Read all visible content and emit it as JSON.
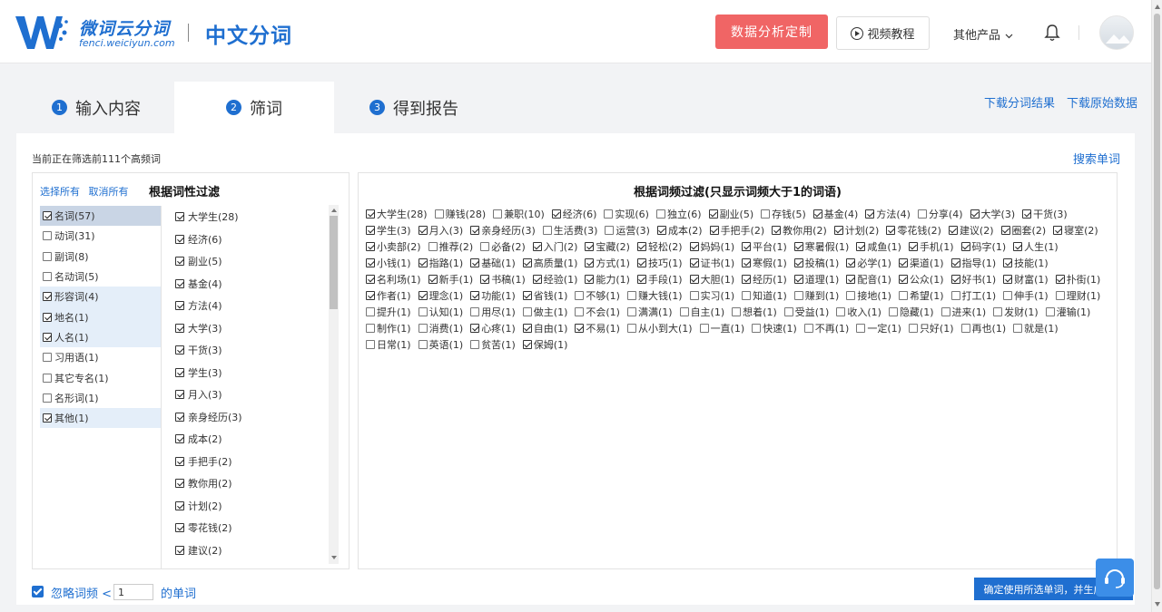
{
  "header": {
    "logo_cn": "微词云分词",
    "logo_en": "fenci.weiciyun.com",
    "subtitle": "中文分词",
    "analysis_button": "数据分析定制",
    "video_button": "视频教程",
    "other_products": "其他产品"
  },
  "steps": [
    {
      "num": "1",
      "label": "输入内容"
    },
    {
      "num": "2",
      "label": "筛词"
    },
    {
      "num": "3",
      "label": "得到报告"
    }
  ],
  "downloads": {
    "segmented": "下载分词结果",
    "raw": "下载原始数据"
  },
  "status": "当前正在筛选前111个高频词",
  "search_word": "搜索单词",
  "left": {
    "select_all": "选择所有",
    "deselect_all": "取消所有",
    "title": "根据词性过滤",
    "pos": [
      {
        "label": "名词(57)",
        "checked": true
      },
      {
        "label": "动词(31)",
        "checked": false
      },
      {
        "label": "副词(8)",
        "checked": false
      },
      {
        "label": "名动词(5)",
        "checked": false
      },
      {
        "label": "形容词(4)",
        "checked": true
      },
      {
        "label": "地名(1)",
        "checked": true
      },
      {
        "label": "人名(1)",
        "checked": true
      },
      {
        "label": "习用语(1)",
        "checked": false
      },
      {
        "label": "其它专名(1)",
        "checked": false
      },
      {
        "label": "名形词(1)",
        "checked": false
      },
      {
        "label": "其他(1)",
        "checked": true
      }
    ],
    "words": [
      "大学生(28)",
      "经济(6)",
      "副业(5)",
      "基金(4)",
      "方法(4)",
      "大学(3)",
      "干货(3)",
      "学生(3)",
      "月入(3)",
      "亲身经历(3)",
      "成本(2)",
      "手把手(2)",
      "教你用(2)",
      "计划(2)",
      "零花钱(2)",
      "建议(2)"
    ]
  },
  "right": {
    "title": "根据词频过滤(只显示词频大于1的词语)",
    "words": [
      {
        "t": "大学生(28)",
        "c": true
      },
      {
        "t": "赚钱(28)",
        "c": false
      },
      {
        "t": "兼职(10)",
        "c": false
      },
      {
        "t": "经济(6)",
        "c": true
      },
      {
        "t": "实现(6)",
        "c": false
      },
      {
        "t": "独立(6)",
        "c": false
      },
      {
        "t": "副业(5)",
        "c": true
      },
      {
        "t": "存钱(5)",
        "c": false
      },
      {
        "t": "基金(4)",
        "c": true
      },
      {
        "t": "方法(4)",
        "c": true
      },
      {
        "t": "分享(4)",
        "c": false
      },
      {
        "t": "大学(3)",
        "c": true
      },
      {
        "t": "干货(3)",
        "c": true
      },
      {
        "t": "学生(3)",
        "c": true
      },
      {
        "t": "月入(3)",
        "c": true
      },
      {
        "t": "亲身经历(3)",
        "c": true
      },
      {
        "t": "生活费(3)",
        "c": false
      },
      {
        "t": "运营(3)",
        "c": false
      },
      {
        "t": "成本(2)",
        "c": true
      },
      {
        "t": "手把手(2)",
        "c": true
      },
      {
        "t": "教你用(2)",
        "c": true
      },
      {
        "t": "计划(2)",
        "c": true
      },
      {
        "t": "零花钱(2)",
        "c": true
      },
      {
        "t": "建议(2)",
        "c": true
      },
      {
        "t": "圈套(2)",
        "c": true
      },
      {
        "t": "寝室(2)",
        "c": true
      },
      {
        "t": "小卖部(2)",
        "c": true
      },
      {
        "t": "推荐(2)",
        "c": false
      },
      {
        "t": "必备(2)",
        "c": false
      },
      {
        "t": "入门(2)",
        "c": true
      },
      {
        "t": "宝藏(2)",
        "c": true
      },
      {
        "t": "轻松(2)",
        "c": true
      },
      {
        "t": "妈妈(1)",
        "c": true
      },
      {
        "t": "平台(1)",
        "c": true
      },
      {
        "t": "寒暑假(1)",
        "c": true
      },
      {
        "t": "咸鱼(1)",
        "c": true
      },
      {
        "t": "手机(1)",
        "c": true
      },
      {
        "t": "码字(1)",
        "c": true
      },
      {
        "t": "人生(1)",
        "c": true
      },
      {
        "t": "小钱(1)",
        "c": true
      },
      {
        "t": "指路(1)",
        "c": true
      },
      {
        "t": "基础(1)",
        "c": true
      },
      {
        "t": "高质量(1)",
        "c": true
      },
      {
        "t": "方式(1)",
        "c": true
      },
      {
        "t": "技巧(1)",
        "c": true
      },
      {
        "t": "证书(1)",
        "c": true
      },
      {
        "t": "寒假(1)",
        "c": true
      },
      {
        "t": "投稿(1)",
        "c": true
      },
      {
        "t": "必学(1)",
        "c": true
      },
      {
        "t": "渠道(1)",
        "c": true
      },
      {
        "t": "指导(1)",
        "c": true
      },
      {
        "t": "技能(1)",
        "c": true
      },
      {
        "t": "名利场(1)",
        "c": true
      },
      {
        "t": "新手(1)",
        "c": true
      },
      {
        "t": "书稿(1)",
        "c": true
      },
      {
        "t": "经验(1)",
        "c": true
      },
      {
        "t": "能力(1)",
        "c": true
      },
      {
        "t": "手段(1)",
        "c": true
      },
      {
        "t": "大胆(1)",
        "c": true
      },
      {
        "t": "经历(1)",
        "c": true
      },
      {
        "t": "道理(1)",
        "c": true
      },
      {
        "t": "配音(1)",
        "c": true
      },
      {
        "t": "公众(1)",
        "c": true
      },
      {
        "t": "好书(1)",
        "c": true
      },
      {
        "t": "财富(1)",
        "c": true
      },
      {
        "t": "扑街(1)",
        "c": true
      },
      {
        "t": "作者(1)",
        "c": true
      },
      {
        "t": "理念(1)",
        "c": true
      },
      {
        "t": "功能(1)",
        "c": true
      },
      {
        "t": "省钱(1)",
        "c": true
      },
      {
        "t": "不够(1)",
        "c": false
      },
      {
        "t": "赚大钱(1)",
        "c": false
      },
      {
        "t": "实习(1)",
        "c": false
      },
      {
        "t": "知道(1)",
        "c": false
      },
      {
        "t": "赚到(1)",
        "c": false
      },
      {
        "t": "接地(1)",
        "c": false
      },
      {
        "t": "希望(1)",
        "c": false
      },
      {
        "t": "打工(1)",
        "c": false
      },
      {
        "t": "伸手(1)",
        "c": false
      },
      {
        "t": "理财(1)",
        "c": false
      },
      {
        "t": "提升(1)",
        "c": false
      },
      {
        "t": "认知(1)",
        "c": false
      },
      {
        "t": "用尽(1)",
        "c": false
      },
      {
        "t": "做主(1)",
        "c": false
      },
      {
        "t": "不会(1)",
        "c": false
      },
      {
        "t": "满满(1)",
        "c": false
      },
      {
        "t": "自主(1)",
        "c": false
      },
      {
        "t": "想着(1)",
        "c": false
      },
      {
        "t": "受益(1)",
        "c": false
      },
      {
        "t": "收入(1)",
        "c": false
      },
      {
        "t": "隐藏(1)",
        "c": false
      },
      {
        "t": "进来(1)",
        "c": false
      },
      {
        "t": "发财(1)",
        "c": false
      },
      {
        "t": "灌输(1)",
        "c": false
      },
      {
        "t": "制作(1)",
        "c": false
      },
      {
        "t": "消费(1)",
        "c": false
      },
      {
        "t": "心疼(1)",
        "c": true
      },
      {
        "t": "自由(1)",
        "c": true
      },
      {
        "t": "不易(1)",
        "c": true
      },
      {
        "t": "从小到大(1)",
        "c": false
      },
      {
        "t": "一直(1)",
        "c": false
      },
      {
        "t": "快速(1)",
        "c": false
      },
      {
        "t": "不再(1)",
        "c": false
      },
      {
        "t": "一定(1)",
        "c": false
      },
      {
        "t": "只好(1)",
        "c": false
      },
      {
        "t": "再也(1)",
        "c": false
      },
      {
        "t": "就是(1)",
        "c": false
      },
      {
        "t": "日常(1)",
        "c": false
      },
      {
        "t": "英语(1)",
        "c": false
      },
      {
        "t": "贫苦(1)",
        "c": false
      },
      {
        "t": "保姆(1)",
        "c": true
      }
    ]
  },
  "bottom": {
    "ignore_prefix": "忽略词频 <",
    "ignore_value": "1",
    "ignore_suffix": "的单词",
    "confirm": "确定使用所选单词，并生成报告"
  }
}
